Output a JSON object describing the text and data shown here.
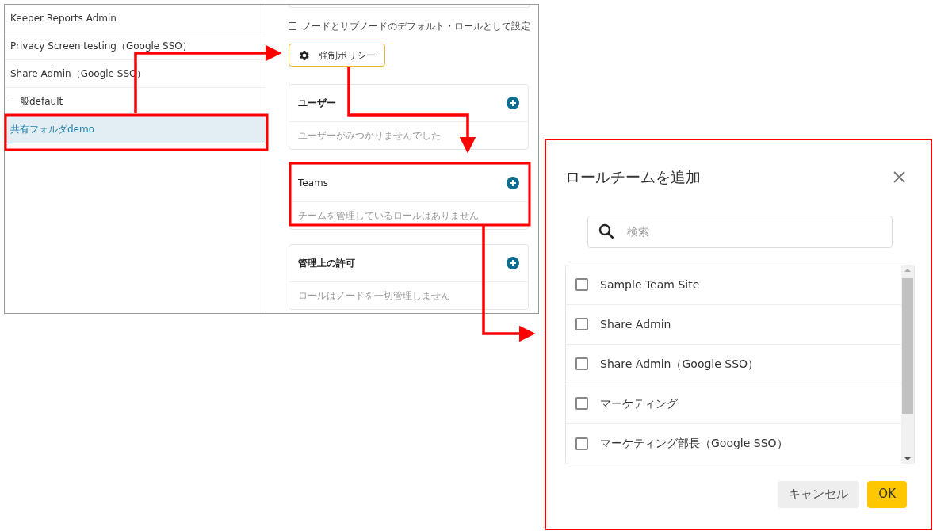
{
  "role_list": {
    "items": [
      {
        "label": "Keeper Reports Admin",
        "selected": false
      },
      {
        "label": "Privacy Screen testing（Google SSO）",
        "selected": false
      },
      {
        "label": "Share Admin（Google SSO）",
        "selected": false
      },
      {
        "label": "一般default",
        "selected": false
      },
      {
        "label": "共有フォルダdemo",
        "selected": true
      }
    ]
  },
  "role_detail": {
    "default_role": {
      "label": "ノードとサブノードのデフォルト・ロールとして設定",
      "checked": false
    },
    "enforce_policy_button": "強制ポリシー",
    "sections": [
      {
        "title": "ユーザー",
        "empty_text": "ユーザーがみつかりませんでした"
      },
      {
        "title": "Teams",
        "empty_text": "チームを管理しているロールはありません"
      },
      {
        "title": "管理上の許可",
        "empty_text": "ロールはノードを一切管理しません"
      }
    ]
  },
  "dialog": {
    "title": "ロールチームを追加",
    "search": {
      "placeholder": "検索"
    },
    "teams": [
      {
        "label": "Sample Team Site",
        "checked": false
      },
      {
        "label": "Share Admin",
        "checked": false
      },
      {
        "label": "Share Admin（Google SSO）",
        "checked": false
      },
      {
        "label": "マーケティング",
        "checked": false
      },
      {
        "label": "マーケティング部長（Google SSO）",
        "checked": false
      }
    ],
    "buttons": [
      {
        "label": "キャンセル",
        "kind": "secondary"
      },
      {
        "label": "OK",
        "kind": "primary"
      }
    ]
  }
}
